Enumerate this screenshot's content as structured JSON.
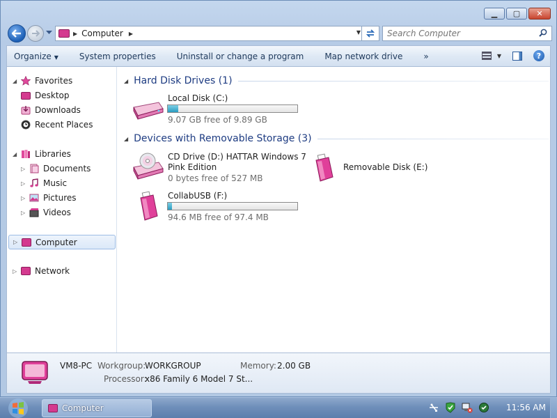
{
  "window": {
    "caption": {
      "minimize_glyph": "▁",
      "maximize_glyph": "▢",
      "close_glyph": "✕"
    }
  },
  "address": {
    "location": "Computer",
    "search_placeholder": "Search Computer"
  },
  "toolbar": {
    "organize": "Organize",
    "system_properties": "System properties",
    "uninstall": "Uninstall or change a program",
    "map_drive": "Map network drive",
    "more": "»"
  },
  "nav": {
    "favorites": "Favorites",
    "desktop": "Desktop",
    "downloads": "Downloads",
    "recent_places": "Recent Places",
    "libraries": "Libraries",
    "documents": "Documents",
    "music": "Music",
    "pictures": "Pictures",
    "videos": "Videos",
    "computer": "Computer",
    "network": "Network"
  },
  "groups": {
    "hard_disks": "Hard Disk Drives (1)",
    "removable": "Devices with Removable Storage (3)"
  },
  "drives": {
    "c": {
      "name": "Local Disk (C:)",
      "info": "9.07 GB free of 9.89 GB",
      "used_fraction": 0.08
    },
    "d": {
      "name_line1": "CD Drive (D:) HATTAR Windows 7",
      "name_line2": "Pink Edition",
      "info": "0 bytes free of 527 MB"
    },
    "e": {
      "name": "Removable Disk (E:)"
    },
    "f": {
      "name": "CollabUSB (F:)",
      "info": "94.6 MB free of 97.4 MB",
      "used_fraction": 0.03
    }
  },
  "details": {
    "pc_name": "VM8-PC",
    "workgroup_label": "Workgroup:",
    "workgroup": "WORKGROUP",
    "memory_label": "Memory:",
    "memory": "2.00 GB",
    "processor_label": "Processor:",
    "processor": "x86 Family 6 Model 7 St..."
  },
  "taskbar": {
    "task_label": "Computer",
    "clock": "11:56 AM"
  },
  "colors": {
    "accent_pink": "#d43a8f",
    "group_header": "#1e3c82",
    "bar_fill": "#2a9cc0"
  }
}
